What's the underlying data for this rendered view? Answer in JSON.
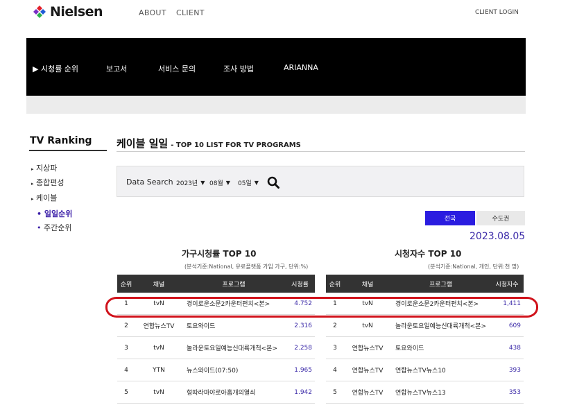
{
  "header": {
    "brand": "Nielsen",
    "nav": [
      "ABOUT",
      "CLIENT"
    ],
    "login": "CLIENT LOGIN",
    "colors": {
      "mark_red": "#e3202b",
      "mark_blue": "#1e5bd6",
      "mark_purple": "#7a2fc4",
      "mark_green": "#2bb14c"
    }
  },
  "mainnav": {
    "items": [
      "▶ 시청률 순위",
      "보고서",
      "서비스 문의",
      "조사 방법",
      "ARIANNA"
    ]
  },
  "sidebar": {
    "title": "TV Ranking",
    "items": [
      "지상파",
      "종합편성",
      "케이블"
    ],
    "subitems": [
      "일일순위",
      "주간순위"
    ]
  },
  "page": {
    "title": "케이블 일일",
    "subtitle": "- TOP 10 LIST FOR TV PROGRAMS"
  },
  "search": {
    "label": "Data Search",
    "year": "2023년",
    "month": "08월",
    "day": "05일",
    "icon": "search-icon"
  },
  "tabs": {
    "active": "전국",
    "inactive": "수도권",
    "active_color": "#2a1ce0"
  },
  "date": "2023.08.05",
  "household": {
    "title": "가구시청률 TOP 10",
    "note": "(분석기준:National, 유료플랫폼 가입 가구, 단위:%)",
    "headers": [
      "순위",
      "채널",
      "프로그램",
      "시청률"
    ],
    "rows": [
      [
        "1",
        "tvN",
        "경이로운소문2카운터펀치<본>",
        "4.752"
      ],
      [
        "2",
        "연합뉴스TV",
        "토요와이드",
        "2.316"
      ],
      [
        "3",
        "tvN",
        "놀라운토요일예능신대륙개척<본>",
        "2.258"
      ],
      [
        "4",
        "YTN",
        "뉴스와이드(07:50)",
        "1.965"
      ],
      [
        "5",
        "tvN",
        "형따라마야로아홉개의열쇠",
        "1.942"
      ]
    ]
  },
  "viewers": {
    "title": "시청자수 TOP 10",
    "note": "(분석기준:National, 개인, 단위:천 명)",
    "headers": [
      "순위",
      "채널",
      "프로그램",
      "시청자수"
    ],
    "rows": [
      [
        "1",
        "tvN",
        "경이로운소문2카운터펀치<본>",
        "1,411"
      ],
      [
        "2",
        "tvN",
        "놀라운토요일예능신대륙개척<본>",
        "609"
      ],
      [
        "3",
        "연합뉴스TV",
        "토요와이드",
        "438"
      ],
      [
        "4",
        "연합뉴스TV",
        "연합뉴스TV뉴스10",
        "393"
      ],
      [
        "5",
        "연합뉴스TV",
        "연합뉴스TV뉴스13",
        "353"
      ]
    ]
  },
  "annotation_color": "#d0121b"
}
